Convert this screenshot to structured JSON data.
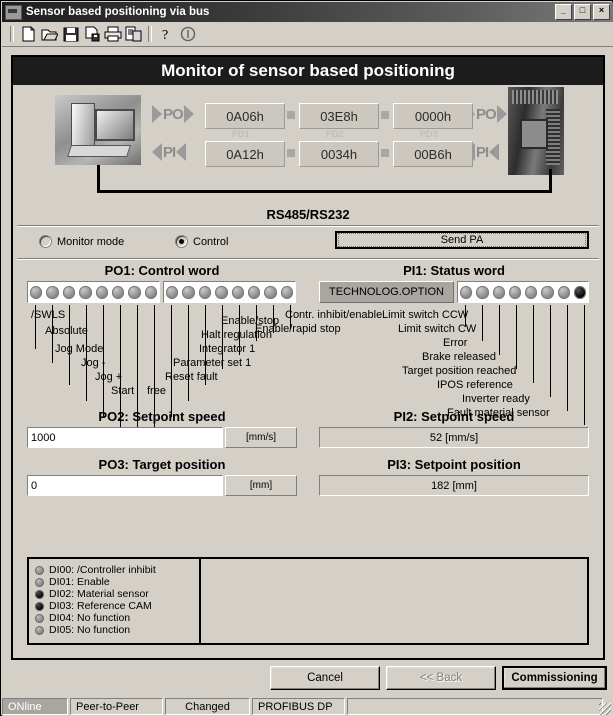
{
  "window": {
    "title": "Sensor based positioning via bus",
    "minimize": "_",
    "maximize": "□",
    "close": "×"
  },
  "toolbar": {
    "icons": [
      "new-document-icon",
      "open-folder-icon",
      "save-disk-icon",
      "save-as-icon",
      "print-icon",
      "print-preview-icon",
      "help-question-icon",
      "about-icon"
    ]
  },
  "panel": {
    "header": "Monitor of sensor based positioning",
    "bus_label": "RS485/RS232",
    "po_arrow_label": "PO",
    "pi_arrow_label": "PI",
    "po_values": [
      "0A06h",
      "03E8h",
      "0000h"
    ],
    "pi_values": [
      "0A12h",
      "0034h",
      "00B6h"
    ],
    "pd_labels": [
      "PD1",
      "PD2",
      "PD3"
    ]
  },
  "mode": {
    "monitor_label": "Monitor mode",
    "monitor_selected": false,
    "control_label": "Control",
    "control_selected": true,
    "send_button": "Send PA"
  },
  "control_word": {
    "title": "PO1: Control word",
    "bits": [
      {
        "label": "/SWLS",
        "on": false
      },
      {
        "label": "Absolute",
        "on": false
      },
      {
        "label": "Jog Mode",
        "on": false
      },
      {
        "label": "Jog -",
        "on": false
      },
      {
        "label": "Jog +",
        "on": false
      },
      {
        "label": "Start",
        "on": false
      },
      {
        "label": "free",
        "on": false
      },
      {
        "label": "Reset fault",
        "on": false
      },
      {
        "label": "Parameter set 1",
        "on": false
      },
      {
        "label": "Integrator 1",
        "on": false
      },
      {
        "label": "Halt regulation",
        "on": false
      },
      {
        "label": "Enable/stop",
        "on": false
      },
      {
        "label": "Enable/rapid stop",
        "on": false
      },
      {
        "label": "Contr. inhibit/enable",
        "on": false
      },
      {
        "label": "",
        "on": false
      },
      {
        "label": "",
        "on": false
      }
    ]
  },
  "status_word": {
    "title": "PI1: Status word",
    "technology_option": "TECHNOLOG.OPTION",
    "bits": [
      {
        "label": "Limit switch CCW",
        "on": false
      },
      {
        "label": "Limit switch CW",
        "on": false
      },
      {
        "label": "Error",
        "on": false
      },
      {
        "label": "Brake released",
        "on": false
      },
      {
        "label": "Target position reached",
        "on": false
      },
      {
        "label": "IPOS reference",
        "on": false
      },
      {
        "label": "Inverter ready",
        "on": false
      },
      {
        "label": "Fault material sensor",
        "on": true
      }
    ]
  },
  "setpoint_speed_out": {
    "title": "PO2: Setpoint speed",
    "value": "1000",
    "unit": "[mm/s]"
  },
  "target_position_out": {
    "title": "PO3: Target position",
    "value": "0",
    "unit": "[mm]"
  },
  "setpoint_speed_in": {
    "title": "PI2: Setpoint speed",
    "value": "52 [mm/s]"
  },
  "setpoint_position_in": {
    "title": "PI3: Setpoint position",
    "value": "182 [mm]"
  },
  "digital_inputs": [
    {
      "label": "DI00: /Controller inhibit",
      "on": false
    },
    {
      "label": "DI01: Enable",
      "on": false
    },
    {
      "label": "DI02: Material sensor",
      "on": true
    },
    {
      "label": "DI03: Reference CAM",
      "on": true
    },
    {
      "label": "DI04: No function",
      "on": false
    },
    {
      "label": "DI05: No function",
      "on": false
    }
  ],
  "buttons": {
    "cancel": "Cancel",
    "back": "<< Back",
    "commissioning": "Commissioning"
  },
  "statusbar": {
    "connection": "ONline",
    "mode": "Peer-to-Peer",
    "state": "Changed",
    "fieldbus": "PROFIBUS DP"
  }
}
